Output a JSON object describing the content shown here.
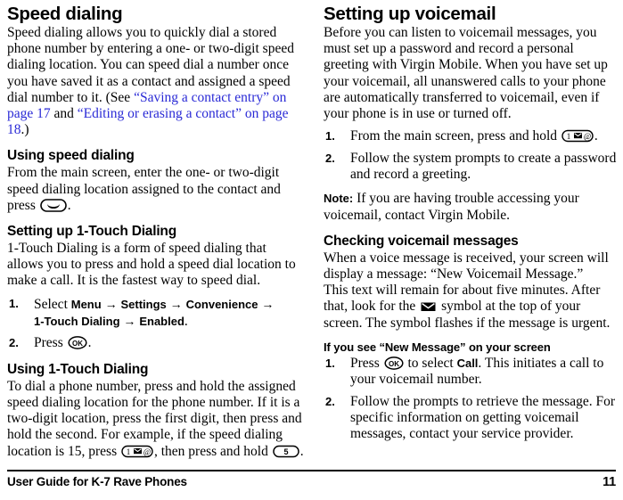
{
  "document": {
    "footer": {
      "title": "User Guide for K-7 Rave Phones",
      "page_number": "11"
    }
  },
  "left_column": {
    "section_title": "Speed dialing",
    "intro": {
      "part1": "Speed dialing allows you to quickly dial a stored phone number by entering a one- or two-digit speed dialing location. You can speed dial a number once you have saved it as a contact and assigned a speed dial number to it. (See ",
      "link1": "“Saving a contact entry” on page 17",
      "between": " and ",
      "link2": "“Editing or erasing a contact” on page 18",
      "part2": ".)"
    },
    "using_speed_dialing": {
      "heading": "Using speed dialing",
      "body_before_key": "From the main screen, enter the one- or two-digit speed dialing location assigned to the contact and press ",
      "body_after_key": "."
    },
    "setting_up_1touch": {
      "heading": "Setting up 1-Touch Dialing",
      "body": "1-Touch Dialing is a form of speed dialing that allows you to press and hold a speed dial location to make a call. It is the fastest way to speed dial.",
      "steps": [
        {
          "number": "1.",
          "prefix": "Select ",
          "menu_path": [
            "Menu",
            "Settings",
            "Convenience",
            "1-Touch Dialing",
            "Enabled"
          ],
          "suffix": "."
        },
        {
          "number": "2.",
          "prefix": "Press ",
          "suffix": "."
        }
      ]
    },
    "using_1touch": {
      "heading": "Using 1-Touch Dialing",
      "body_part1": "To dial a phone number, press and hold the assigned speed dialing location for the phone number. If it is a two-digit location, press the first digit, then press and hold the second. For example, if the speed dialing location is 15, press ",
      "body_part2": ", then press and hold ",
      "body_part3": "."
    }
  },
  "right_column": {
    "section_title": "Setting up voicemail",
    "intro": "Before you can listen to voicemail messages, you must set up a password and record a personal greeting with Virgin Mobile. When you have set up your voicemail, all unanswered calls to your phone are automatically transferred to voicemail, even if your phone is in use or turned off.",
    "steps": [
      {
        "number": "1.",
        "prefix": "From the main screen, press and hold ",
        "suffix": "."
      },
      {
        "number": "2.",
        "text": "Follow the system prompts to create a password and record a greeting."
      }
    ],
    "note": {
      "label": "Note:",
      "text": " If you are having trouble accessing your voicemail, contact Virgin Mobile."
    },
    "checking": {
      "heading": "Checking voicemail messages",
      "body_part1": "When a voice message is received, your screen will display a message: “New Voicemail Message.”",
      "body_part2": "This text will remain for about five minutes. After that, look for the ",
      "body_part3": " symbol at the top of your screen. The symbol flashes if the message is urgent."
    },
    "new_message": {
      "heading": "If you see “New Message” on your screen",
      "steps": [
        {
          "number": "1.",
          "prefix": "Press ",
          "mid": " to select ",
          "ui": "Call",
          "suffix": ". This initiates a call to your voicemail number."
        },
        {
          "number": "2.",
          "text": "Follow the prompts to retrieve the message. For specific information on getting voicemail messages, contact your service provider."
        }
      ]
    }
  },
  "icons": {
    "send_key": "send-key-icon",
    "ok_key": "ok-key-icon",
    "one_key": "one-key-icon",
    "five_key": "five-key-icon",
    "envelope": "envelope-icon"
  },
  "colors": {
    "text": "#000000",
    "link": "#2a2ad6",
    "background": "#ffffff"
  }
}
